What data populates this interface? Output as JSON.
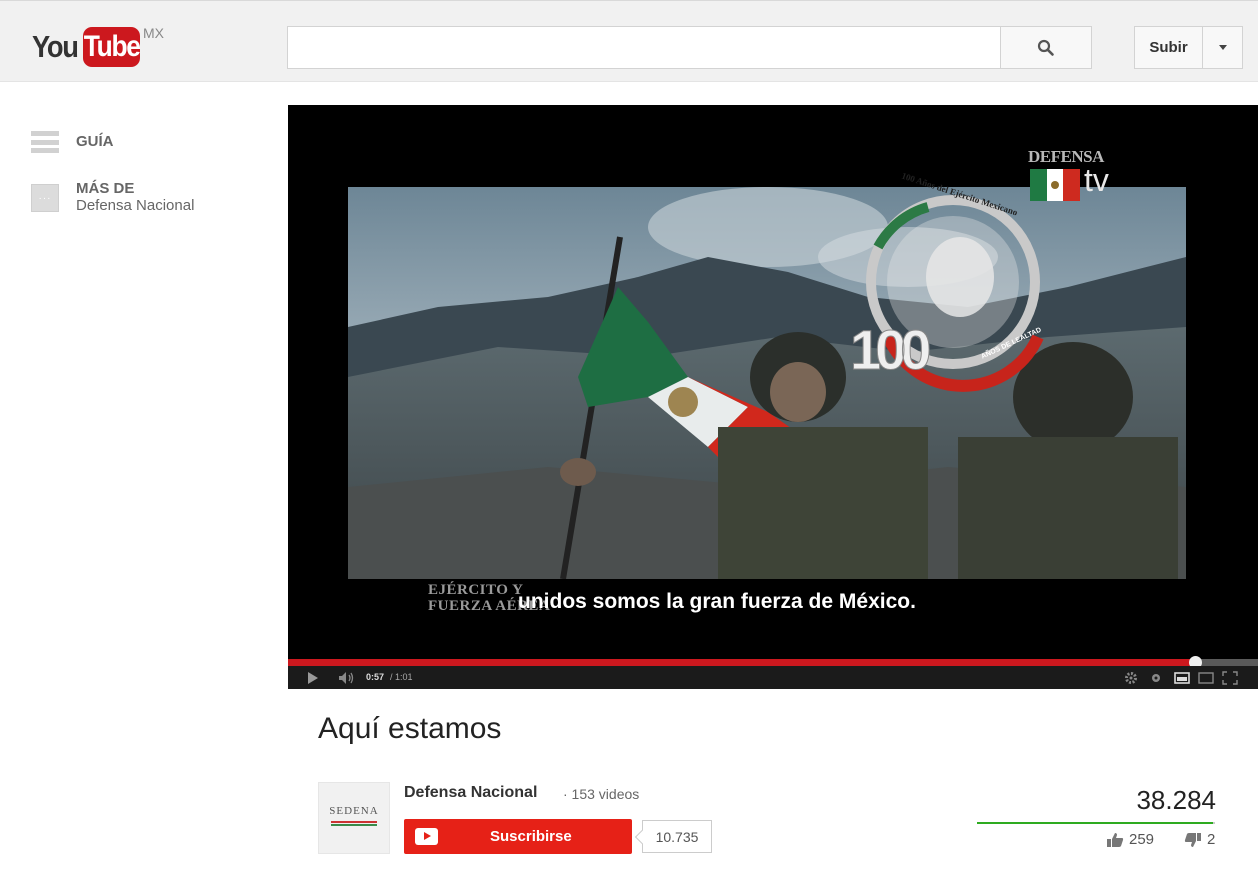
{
  "logo": {
    "part1": "You",
    "part2": "Tube",
    "country": "MX"
  },
  "search": {
    "placeholder": "",
    "value": ""
  },
  "header": {
    "upload_label": "Subir"
  },
  "guide": {
    "menu_label": "GUÍA",
    "more_label": "MÁS DE",
    "more_channel": "Defensa Nacional"
  },
  "player": {
    "time_current": "0:57",
    "time_total": "/ 1:01",
    "progress": 0.935,
    "subtitle": "unidos somos la gran fuerza de México.",
    "overlay_line1": "EJÉRCITO Y",
    "overlay_line2": "FUERZA AÉREA",
    "brand_defensa": "DEFENSA",
    "brand_tv": "tv",
    "badge_top": "100 Años del Ejército Mexicano",
    "badge_number": "100",
    "badge_bottom": "AÑOS DE LEALTAD"
  },
  "video": {
    "title": "Aquí estamos",
    "channel_name": "Defensa Nacional",
    "channel_videos": "· 153 videos",
    "channel_thumb_text": "SEDENA",
    "subscribe_label": "Suscribirse",
    "subscriber_count": "10.735",
    "view_count": "38.284",
    "likes": "259",
    "dislikes": "2",
    "like_ratio": 0.99
  },
  "colors": {
    "accent_red": "#cc181e",
    "subscribe_red": "#e62117",
    "like_green": "#2eab20"
  }
}
